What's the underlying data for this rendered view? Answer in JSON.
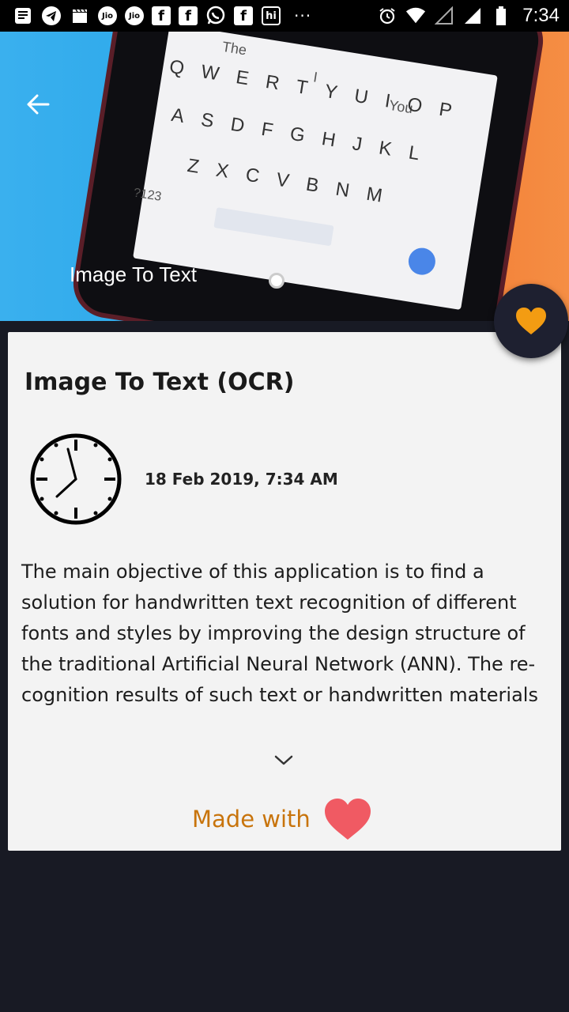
{
  "status_bar": {
    "time": "7:34",
    "jio_label": "Jio",
    "fb_label": "f",
    "hi_label": "hi",
    "more": "···",
    "icons": [
      "news-icon",
      "telegram-icon",
      "clapper-icon",
      "jio-icon",
      "jio-icon",
      "facebook-icon",
      "facebook-icon",
      "whatsapp-icon",
      "facebook-icon",
      "hi-icon",
      "alarm-icon",
      "wifi-icon",
      "signal-icon",
      "signal-icon",
      "battery-icon"
    ]
  },
  "hero": {
    "title": "Image To Text",
    "keyboard": {
      "suggestions": [
        "The",
        "I",
        "You"
      ],
      "row1": "QWERTYUIOP",
      "row2": "ASDFGHJKL",
      "row3": "ZXCVBNM",
      "symbols_key": "?123"
    },
    "back_icon": "arrow-left-icon"
  },
  "fab": {
    "icon": "heart-icon",
    "color": "#f39c12"
  },
  "card": {
    "title": "Image To Text (OCR)",
    "date": "18 Feb 2019, 7:34 AM",
    "description": "The main objective of this application is to find a solution for handwritten text recognition of different fonts and styles by improving the design structure of the traditional Artificial Neural Network (ANN). The re-cognition results of such text or handwritten materials",
    "expand_icon": "chevron-down-icon",
    "made_with": "Made with",
    "made_with_heart_color": "#f05a63"
  },
  "colors": {
    "background": "#181a24",
    "card": "#f3f3f3",
    "accent": "#c8740c"
  }
}
